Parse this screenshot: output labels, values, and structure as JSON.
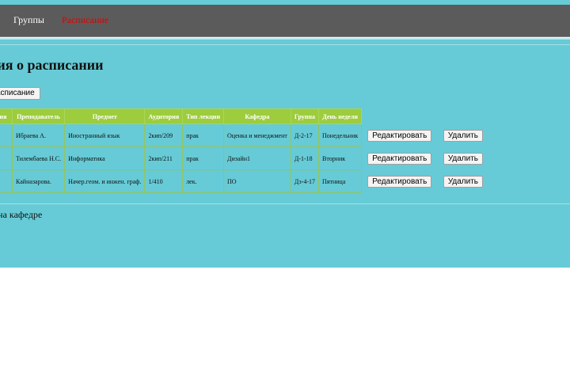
{
  "nav": {
    "items": [
      "Группы",
      "Расписание"
    ],
    "active": "Расписание"
  },
  "page": {
    "title": "ция о расписании",
    "add_button_label": "е расписание",
    "footer_text": "ние на кафедре"
  },
  "table": {
    "headers": [
      "тия",
      "Преподаватель",
      "Предмет",
      "Аудитория",
      "Тип лекции",
      "Кафедра",
      "Группа",
      "День недели"
    ],
    "rows": [
      [
        "",
        "Ибраева А.",
        "Иностранный язык",
        "2кип/209",
        "прак",
        "Оценка и менеджмент",
        "Д-2-17",
        "Понедельник"
      ],
      [
        "",
        "Тилембаева Н.С.",
        "Информатика",
        "2кип/211",
        "прак",
        "Дизайн1",
        "Д-1-18",
        "Вторник"
      ],
      [
        "",
        "Кайназарова.",
        "Начер.геом. и инжен. граф.",
        "1/410",
        "лек.",
        "ПО",
        "Дз-4-17",
        "Пятница"
      ]
    ],
    "edit_label": "Редактировать",
    "delete_label": "Удалить"
  },
  "colors": {
    "navbar": "#5b5b5b",
    "content": "#66cbd6",
    "header": "#9dcc3c",
    "active_nav": "#e00000"
  }
}
